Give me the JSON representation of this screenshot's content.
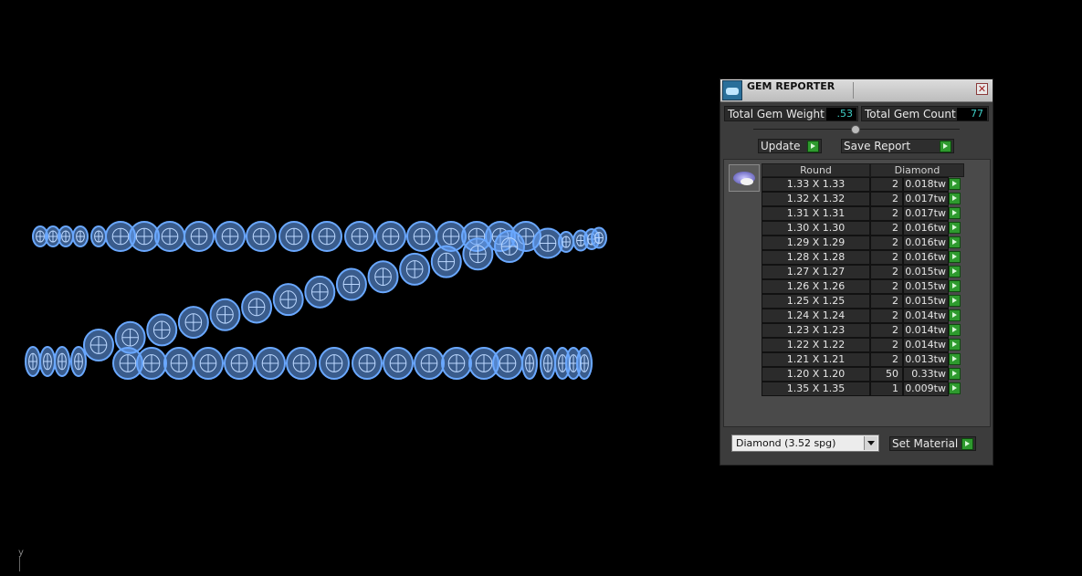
{
  "viewport": {
    "axis_label": "y"
  },
  "panel": {
    "title": "GEM REPORTER",
    "close_glyph": "✕",
    "total_weight_label": "Total Gem Weight",
    "total_weight_value": ".53",
    "total_count_label": "Total Gem Count",
    "total_count_value": "77",
    "update_label": "Update",
    "save_report_label": "Save Report",
    "table": {
      "col_shape": "Round",
      "col_material": "Diamond",
      "rows": [
        {
          "size": "1.33 X 1.33",
          "count": "2",
          "weight": "0.018tw"
        },
        {
          "size": "1.32 X 1.32",
          "count": "2",
          "weight": "0.017tw"
        },
        {
          "size": "1.31 X 1.31",
          "count": "2",
          "weight": "0.017tw"
        },
        {
          "size": "1.30 X 1.30",
          "count": "2",
          "weight": "0.016tw"
        },
        {
          "size": "1.29 X 1.29",
          "count": "2",
          "weight": "0.016tw"
        },
        {
          "size": "1.28 X 1.28",
          "count": "2",
          "weight": "0.016tw"
        },
        {
          "size": "1.27 X 1.27",
          "count": "2",
          "weight": "0.015tw"
        },
        {
          "size": "1.26 X 1.26",
          "count": "2",
          "weight": "0.015tw"
        },
        {
          "size": "1.25 X 1.25",
          "count": "2",
          "weight": "0.015tw"
        },
        {
          "size": "1.24 X 1.24",
          "count": "2",
          "weight": "0.014tw"
        },
        {
          "size": "1.23 X 1.23",
          "count": "2",
          "weight": "0.014tw"
        },
        {
          "size": "1.22 X 1.22",
          "count": "2",
          "weight": "0.014tw"
        },
        {
          "size": "1.21 X 1.21",
          "count": "2",
          "weight": "0.013tw"
        },
        {
          "size": "1.20 X 1.20",
          "count": "50",
          "weight": "0.33tw"
        },
        {
          "size": "1.35 X 1.35",
          "count": "1",
          "weight": "0.009tw"
        }
      ]
    },
    "material_select": "Diamond     (3.52 spg)",
    "set_material_label": "Set Material"
  },
  "colors": {
    "gem_wire": "#6aa8ff",
    "accent_green": "#2e9a2e",
    "value_text": "#3fd0c8"
  },
  "icons": [
    "gem-reporter-app-icon",
    "close-icon",
    "play-arrow-icon",
    "dropdown-arrow-icon",
    "gem-thumbnail-icon"
  ]
}
